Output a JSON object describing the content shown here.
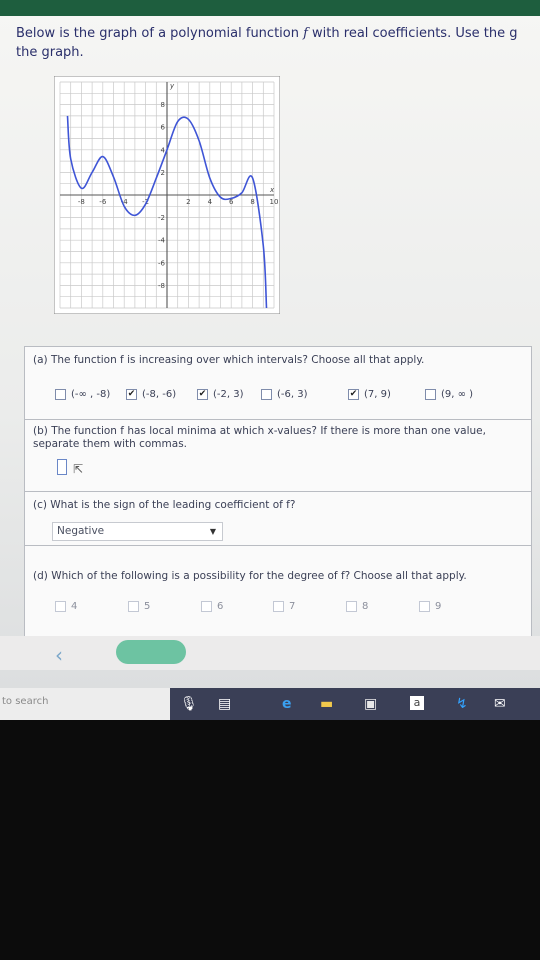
{
  "question": {
    "line1_a": "Below is the graph of a polynomial function ",
    "func": "f",
    "line1_b": " with real coefficients. Use the g",
    "line2": "the graph."
  },
  "graph": {
    "x_ticks": [
      "-8",
      "-6",
      "-4",
      "-2",
      "2",
      "4",
      "6",
      "8",
      "10"
    ],
    "y_ticks": [
      "8",
      "6",
      "4",
      "2",
      "-2",
      "-4",
      "-6",
      "-8"
    ],
    "x_axis_label": "x",
    "y_axis_label": "y",
    "chart_data": {
      "type": "line",
      "xlim": [
        -10,
        10
      ],
      "ylim": [
        -10,
        10
      ],
      "grid": true,
      "series": [
        {
          "x": [
            -9.3,
            -9,
            -8,
            -7,
            -6,
            -5,
            -4,
            -3,
            -2,
            -1,
            0,
            1,
            2,
            3,
            4,
            5,
            6,
            7,
            8,
            9,
            9.3
          ],
          "y": [
            7.0,
            3.2,
            0.6,
            2.0,
            3.4,
            1.6,
            -1.0,
            -1.8,
            -0.8,
            1.5,
            4.0,
            6.5,
            6.7,
            4.8,
            1.5,
            -0.2,
            -0.3,
            0.2,
            1.5,
            -4.5,
            -11
          ]
        }
      ],
      "color": "#3f55d6"
    }
  },
  "part_a": {
    "question": "(a) The function f is increasing over which intervals? Choose all that apply.",
    "options": [
      {
        "label": "(-∞ , -8)",
        "checked": false
      },
      {
        "label": "(-8, -6)",
        "checked": true
      },
      {
        "label": "(-2, 3)",
        "checked": true
      },
      {
        "label": "(-6, 3)",
        "checked": false
      },
      {
        "label": "(7, 9)",
        "checked": true
      },
      {
        "label": "(9, ∞ )",
        "checked": false
      }
    ]
  },
  "part_b": {
    "line1": "(b) The function f has local minima at which x-values? If there is more than one value,",
    "line2": "separate them with commas.",
    "answer": ""
  },
  "part_c": {
    "question": "(c) What is the sign of the leading coefficient of f?",
    "selected": "Negative"
  },
  "part_d": {
    "question": "(d) Which of the following is a possibility for the degree of f? Choose all that apply.",
    "options": [
      "4",
      "5",
      "6",
      "7",
      "8",
      "9"
    ]
  },
  "taskbar": {
    "search_text": "to search"
  },
  "colors": {
    "curve": "#3f55d6",
    "taskbar": "#3a3f56",
    "next_button": "#6dc3a2"
  }
}
